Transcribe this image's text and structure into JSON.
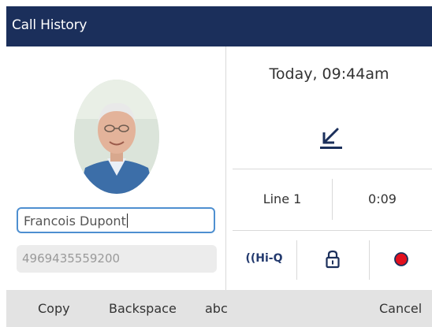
{
  "window": {
    "title": "Call History"
  },
  "contact": {
    "name_value": "Francois Dupont",
    "number_value": "4969435559200"
  },
  "call": {
    "datetime": "Today, 09:44am",
    "direction_icon": "outgoing-call-arrow-icon",
    "line": "Line 1",
    "duration": "0:09"
  },
  "features": {
    "hiq_label": "Hi-Q",
    "lock_icon": "lock-icon",
    "record_icon": "record-dot-icon"
  },
  "softkeys": {
    "copy": "Copy",
    "backspace": "Backspace",
    "abc": "abc",
    "cancel": "Cancel"
  },
  "colors": {
    "titlebar": "#1b2f5b",
    "accent_blue": "#4e8fd0",
    "record_red": "#e2101e"
  }
}
